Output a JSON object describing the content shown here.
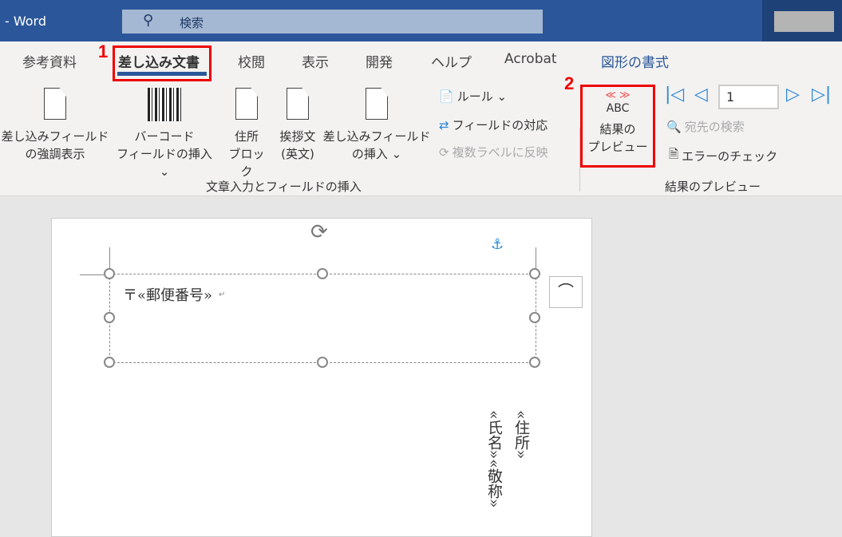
{
  "titlebar": {
    "app": "-  Word",
    "search_placeholder": "検索"
  },
  "tabs": [
    {
      "label": "参考資料"
    },
    {
      "label": "差し込み文書",
      "active": true
    },
    {
      "label": "校閲"
    },
    {
      "label": "表示"
    },
    {
      "label": "開発"
    },
    {
      "label": "ヘルプ"
    },
    {
      "label": "Acrobat"
    },
    {
      "label": "図形の書式",
      "contextual": true
    }
  ],
  "annotations": {
    "one": "1",
    "two": "2"
  },
  "ribbon": {
    "highlight_fields": [
      "差し込みフィールド",
      "の強調表示"
    ],
    "barcode": [
      "バーコード",
      "フィールドの挿入 ⌄"
    ],
    "address_block": [
      "住所",
      "ブロック"
    ],
    "greeting": [
      "挨拶文",
      "(英文)"
    ],
    "insert_field": [
      "差し込みフィールド",
      "の挿入 ⌄"
    ],
    "rules": "ルール ⌄",
    "match_fields": "フィールドの対応",
    "update_labels": "複数ラベルに反映",
    "group1": "文章入力とフィールドの挿入",
    "preview_icon_top": "≪ ≫",
    "preview_icon_text": "ABC",
    "preview": [
      "結果の",
      "プレビュー"
    ],
    "record_number": "1",
    "find_recipient": "宛先の検索",
    "check_errors": "エラーのチェック",
    "group2": "結果のプレビュー"
  },
  "document": {
    "postal": "〒«郵便番号»",
    "address": "«住所»",
    "name": "«氏名»«敬称»",
    "para_mark": "↵"
  },
  "colors": {
    "title_bar": "#2b579a",
    "accent": "#2b579a",
    "annotation": "#ee0000",
    "nav_arrows": "#2b88d8"
  }
}
